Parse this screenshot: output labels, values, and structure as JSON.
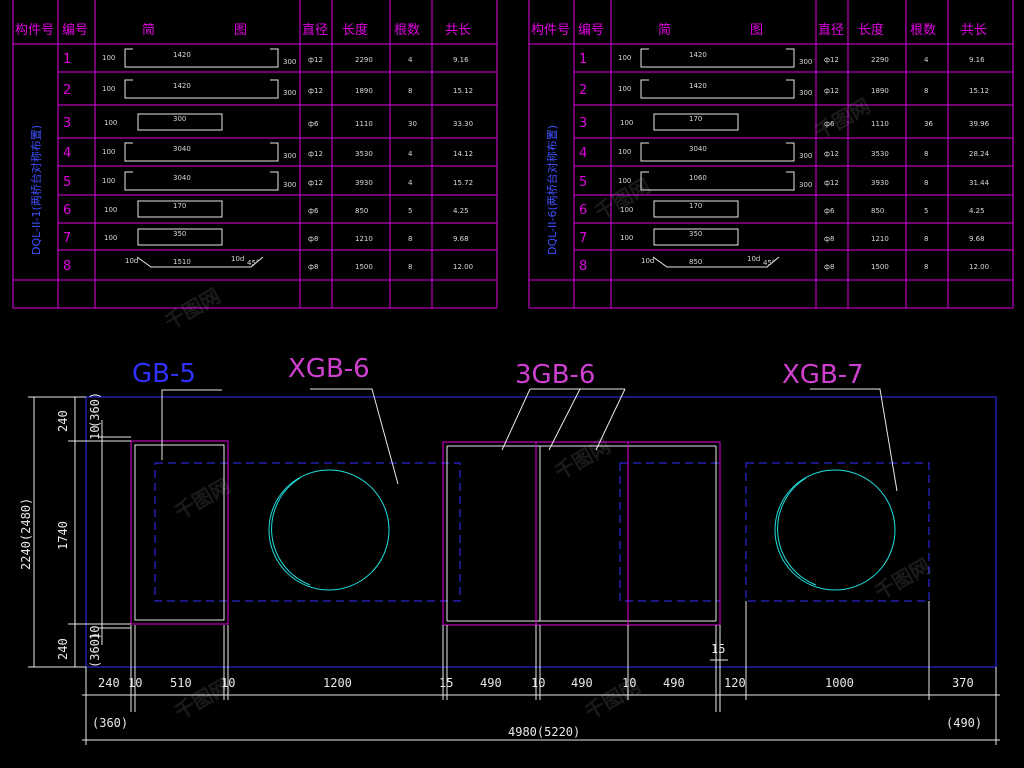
{
  "tables": [
    {
      "headers": [
        "构件号",
        "编号",
        "简",
        "图",
        "直径",
        "长度",
        "根数",
        "共长"
      ],
      "group_label": "DQL-II-1(两桥台对称布置)",
      "rows": [
        {
          "no": "1",
          "fig_left": "100",
          "fig_mid": "1420",
          "fig_right": "300",
          "dia": "ф12",
          "len": "2290",
          "count": "4",
          "total": "9.16"
        },
        {
          "no": "2",
          "fig_left": "100",
          "fig_mid": "1420",
          "fig_right": "300",
          "dia": "ф12",
          "len": "1890",
          "count": "8",
          "total": "15.12"
        },
        {
          "no": "3",
          "fig_left": "100",
          "fig_mid": "300",
          "fig_right": "",
          "dia": "ф6",
          "len": "1110",
          "count": "30",
          "total": "33.30"
        },
        {
          "no": "4",
          "fig_left": "100",
          "fig_mid": "3040",
          "fig_right": "300",
          "dia": "ф12",
          "len": "3530",
          "count": "4",
          "total": "14.12"
        },
        {
          "no": "5",
          "fig_left": "100",
          "fig_mid": "3040",
          "fig_right": "300",
          "dia": "ф12",
          "len": "3930",
          "count": "4",
          "total": "15.72"
        },
        {
          "no": "6",
          "fig_left": "100",
          "fig_mid": "170",
          "fig_right": "",
          "dia": "ф6",
          "len": "850",
          "count": "5",
          "total": "4.25"
        },
        {
          "no": "7",
          "fig_left": "100",
          "fig_mid": "350",
          "fig_right": "",
          "dia": "ф8",
          "len": "1210",
          "count": "8",
          "total": "9.68"
        },
        {
          "no": "8",
          "fig_left": "10d",
          "fig_mid": "1510",
          "fig_right": "10d",
          "dia": "ф8",
          "len": "1500",
          "count": "8",
          "total": "12.00",
          "angle": "45°"
        }
      ]
    },
    {
      "headers": [
        "构件号",
        "编号",
        "简",
        "图",
        "直径",
        "长度",
        "根数",
        "共长"
      ],
      "group_label": "DQL-II-6(两桥台对称布置)",
      "rows": [
        {
          "no": "1",
          "fig_left": "100",
          "fig_mid": "1420",
          "fig_right": "300",
          "dia": "ф12",
          "len": "2290",
          "count": "4",
          "total": "9.16"
        },
        {
          "no": "2",
          "fig_left": "100",
          "fig_mid": "1420",
          "fig_right": "300",
          "dia": "ф12",
          "len": "1890",
          "count": "8",
          "total": "15.12"
        },
        {
          "no": "3",
          "fig_left": "100",
          "fig_mid": "170",
          "fig_right": "",
          "dia": "ф6",
          "len": "1110",
          "count": "36",
          "total": "39.96"
        },
        {
          "no": "4",
          "fig_left": "100",
          "fig_mid": "3040",
          "fig_right": "300",
          "dia": "ф12",
          "len": "3530",
          "count": "8",
          "total": "28.24"
        },
        {
          "no": "5",
          "fig_left": "100",
          "fig_mid": "1060",
          "fig_right": "300",
          "dia": "ф12",
          "len": "3930",
          "count": "8",
          "total": "31.44"
        },
        {
          "no": "6",
          "fig_left": "100",
          "fig_mid": "170",
          "fig_right": "",
          "dia": "ф6",
          "len": "850",
          "count": "5",
          "total": "4.25"
        },
        {
          "no": "7",
          "fig_left": "100",
          "fig_mid": "350",
          "fig_right": "",
          "dia": "ф8",
          "len": "1210",
          "count": "8",
          "total": "9.68"
        },
        {
          "no": "8",
          "fig_left": "10d",
          "fig_mid": "850",
          "fig_right": "10d",
          "dia": "ф8",
          "len": "1500",
          "count": "8",
          "total": "12.00",
          "angle": "45°"
        }
      ]
    }
  ],
  "plan": {
    "labels": {
      "gb5": "GB-5",
      "xgb6": "XGB-6",
      "3gb6": "3GB-6",
      "xgb7": "XGB-7"
    },
    "left_dims": {
      "top": "240",
      "top_alt": "(360)",
      "top_small": "10",
      "mid": "1740",
      "bottom": "240",
      "bottom_alt": "(360)",
      "bottom_small": "10",
      "total": "2240(2480)"
    },
    "bottom_dims": [
      "240",
      "10",
      "510",
      "10",
      "1200",
      "15",
      "490",
      "10",
      "490",
      "10",
      "490",
      "120",
      "1000",
      "370"
    ],
    "top_small_dim": "15",
    "overall": "4980(5220)",
    "left_alt": "(360)",
    "right_alt": "(490)"
  },
  "watermark": "千图网"
}
